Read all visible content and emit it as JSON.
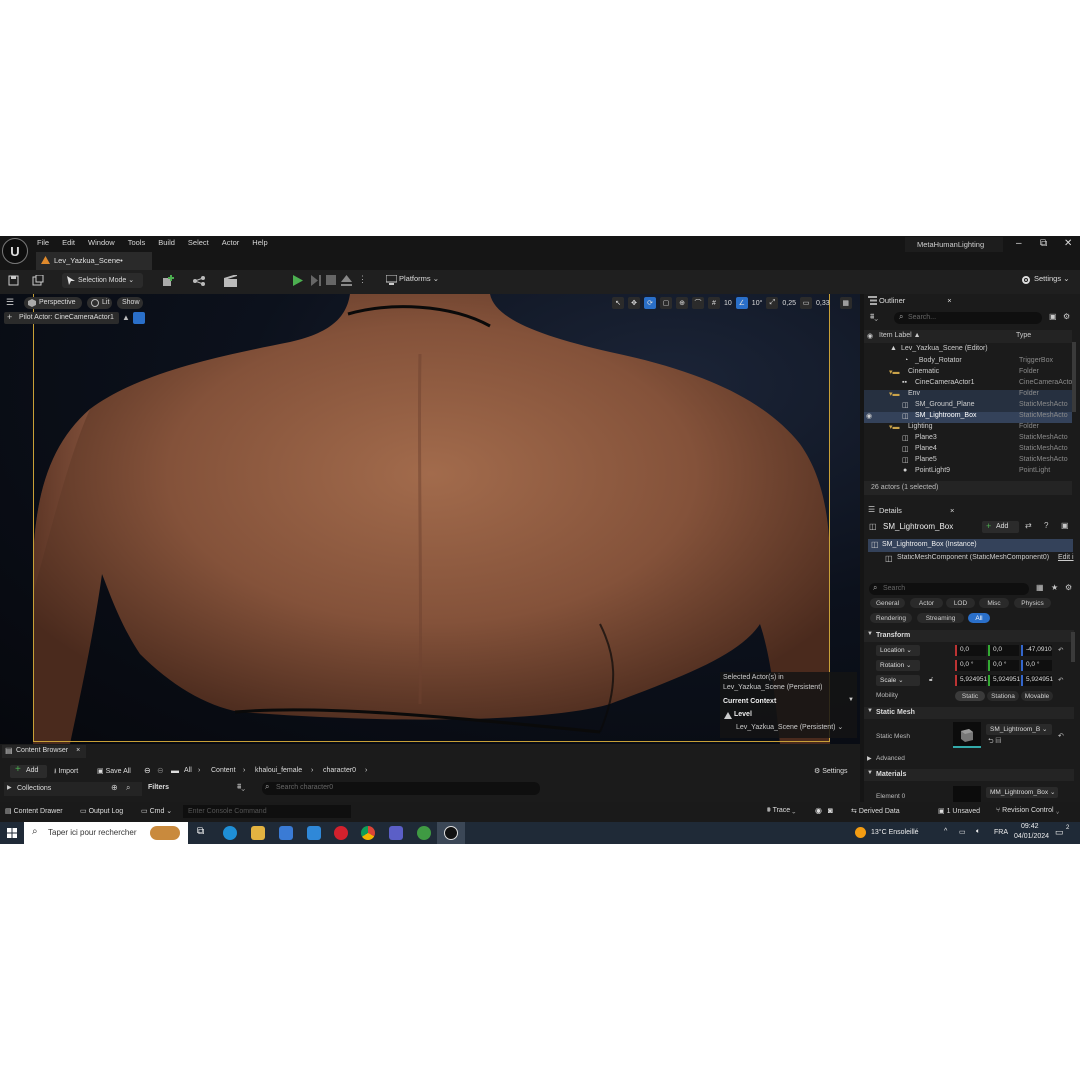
{
  "menu": {
    "items": [
      "File",
      "Edit",
      "Window",
      "Tools",
      "Build",
      "Select",
      "Actor",
      "Help"
    ],
    "project_title": "MetaHumanLighting",
    "window_controls": {
      "minimize": "–",
      "restore": "⧉",
      "close": "✕"
    }
  },
  "level_tab": {
    "label": "Lev_Yazkua_Scene•"
  },
  "toolbar": {
    "selection_mode": "Selection Mode",
    "platforms": "Platforms",
    "settings": "Settings"
  },
  "viewport": {
    "perspective": "Perspective",
    "lit": "Lit",
    "show": "Show",
    "pilot_actor": "Pilot Actor: CineCameraActor1",
    "grid_value": "10",
    "angle_value": "10°",
    "scale_value": "0,25",
    "camera_speed": "0,33",
    "context": {
      "selected_line1": "Selected Actor(s) in",
      "selected_line2": "Lev_Yazkua_Scene (Persistent)",
      "current_context": "Current Context",
      "level_label": "Level",
      "level_value": "Lev_Yazkua_Scene (Persistent)"
    }
  },
  "outliner": {
    "title": "Outliner",
    "search_placeholder": "Search...",
    "col_label": "Item Label ▲",
    "col_type": "Type",
    "rows": [
      {
        "label": "Lev_Yazkua_Scene (Editor)",
        "type": ""
      },
      {
        "label": "_Body_Rotator",
        "type": "TriggerBox"
      },
      {
        "label": "Cinematic",
        "type": "Folder"
      },
      {
        "label": "CineCameraActor1",
        "type": "CineCameraActo"
      },
      {
        "label": "Env",
        "type": "Folder"
      },
      {
        "label": "SM_Ground_Plane",
        "type": "StaticMeshActo"
      },
      {
        "label": "SM_Lightroom_Box",
        "type": "StaticMeshActo"
      },
      {
        "label": "Lighting",
        "type": "Folder"
      },
      {
        "label": "Plane3",
        "type": "StaticMeshActo"
      },
      {
        "label": "Plane4",
        "type": "StaticMeshActo"
      },
      {
        "label": "Plane5",
        "type": "StaticMeshActo"
      },
      {
        "label": "PointLight9",
        "type": "PointLight"
      }
    ],
    "footer": "26 actors (1 selected)"
  },
  "details": {
    "title": "Details",
    "object_name": "SM_Lightroom_Box",
    "add": "Add",
    "instance": "SM_Lightroom_Box (Instance)",
    "component": "StaticMeshComponent (StaticMeshComponent0)",
    "edit": "Edit i",
    "search_placeholder": "Search",
    "filters_row1": [
      "General",
      "Actor",
      "LOD",
      "Misc",
      "Physics"
    ],
    "filters_row2": [
      "Rendering",
      "Streaming",
      "All"
    ],
    "transform_title": "Transform",
    "location_label": "Location",
    "location": [
      "0,0",
      "0,0",
      "-47,0910"
    ],
    "rotation_label": "Rotation",
    "rotation": [
      "0,0 °",
      "0,0 °",
      "0,0 °"
    ],
    "scale_label": "Scale",
    "scale": [
      "5,924951",
      "5,924951",
      "5,924951"
    ],
    "mobility_label": "Mobility",
    "mobility": [
      "Static",
      "Stationa",
      "Movable"
    ],
    "static_mesh_title": "Static Mesh",
    "static_mesh_label": "Static Mesh",
    "static_mesh_value": "SM_Lightroom_B",
    "advanced": "Advanced",
    "materials_title": "Materials",
    "element0": "Element 0",
    "element0_value": "MM_Lightroom_Box"
  },
  "content_browser": {
    "tab": "Content Browser",
    "add": "Add",
    "import": "Import",
    "save_all": "Save All",
    "path": [
      "All",
      "Content",
      "khaloui_female",
      "character0"
    ],
    "settings": "Settings",
    "collections": "Collections",
    "filters": "Filters",
    "search_placeholder": "Search character0"
  },
  "bottom_bar": {
    "content_drawer": "Content Drawer",
    "output_log": "Output Log",
    "cmd": "Cmd",
    "console_placeholder": "Enter Console Command",
    "trace": "Trace",
    "derived_data": "Derived Data",
    "unsaved": "1 Unsaved",
    "revision_control": "Revision Control"
  },
  "taskbar": {
    "search": "Taper ici pour rechercher",
    "weather": "13°C  Ensoleillé",
    "lang": "FRA",
    "time": "09:42",
    "date": "04/01/2024",
    "notifications": "2"
  },
  "colors": {
    "accent": "#2a6fc9",
    "selected_row": "#34425a",
    "viewport_border": "#c8a037",
    "play_green": "#4caf50"
  }
}
